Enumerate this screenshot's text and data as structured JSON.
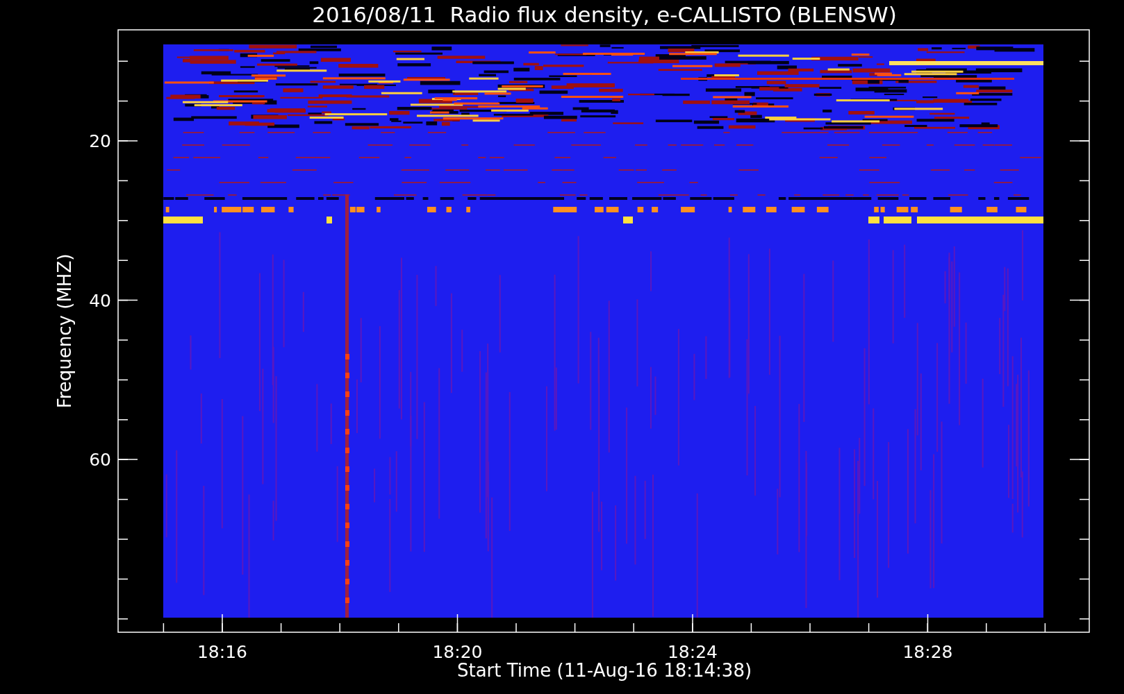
{
  "title": "2016/08/11  Radio flux density, e-CALLISTO (BLENSW)",
  "x_axis": {
    "label": "Start Time (11-Aug-16 18:14:38)",
    "ticks": [
      "18:16",
      "18:20",
      "18:24",
      "18:28"
    ]
  },
  "y_axis": {
    "label": "Frequency (MHZ)",
    "ticks": [
      "20",
      "40",
      "60"
    ]
  }
}
